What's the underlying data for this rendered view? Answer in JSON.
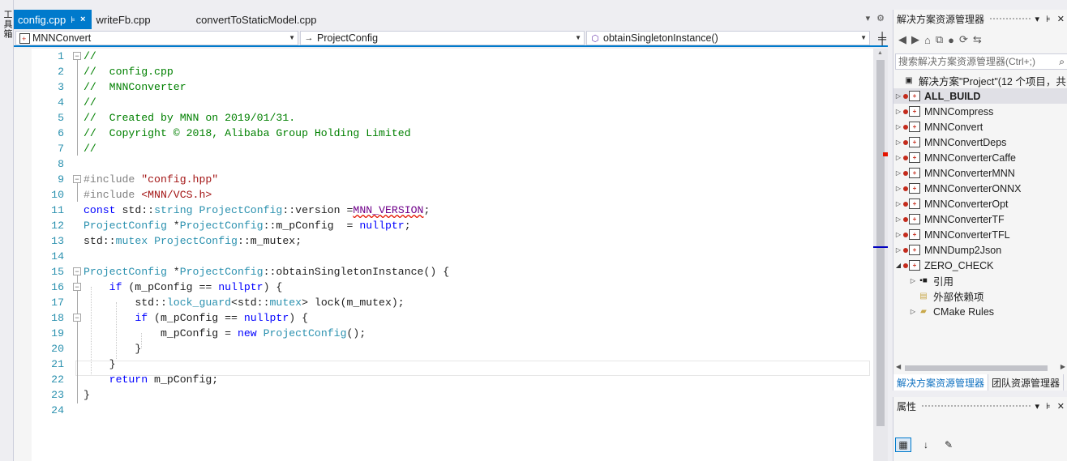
{
  "toolbox": {
    "label": "工具箱"
  },
  "tabs": [
    {
      "label": "config.cpp",
      "pin": "⊧",
      "close": "×"
    },
    {
      "label": "writeFb.cpp"
    },
    {
      "label": "convertToStaticModel.cpp"
    }
  ],
  "tab_overflow": {
    "dropdown": "▾",
    "settings": "⚙"
  },
  "nav": {
    "project": "MNNConvert",
    "scope": "ProjectConfig",
    "member": "obtainSingletonInstance()"
  },
  "code_lines": [
    {
      "n": "1",
      "text": "//"
    },
    {
      "n": "2",
      "text": "//  config.cpp"
    },
    {
      "n": "3",
      "text": "//  MNNConverter"
    },
    {
      "n": "4",
      "text": "//"
    },
    {
      "n": "5",
      "text": "//  Created by MNN on 2019/01/31."
    },
    {
      "n": "6",
      "text": "//  Copyright © 2018, Alibaba Group Holding Limited"
    },
    {
      "n": "7",
      "text": "//"
    },
    {
      "n": "8",
      "text": ""
    },
    {
      "n": "9",
      "pp": "#include ",
      "str": "\"config.hpp\""
    },
    {
      "n": "10",
      "pp": "#include ",
      "str": "<MNN/VCS.h>"
    },
    {
      "n": "11",
      "kw": "const",
      "t1": " std::",
      "ty": "string",
      "t2": " ",
      "ty2": "ProjectConfig",
      "t3": "::version =",
      "mac": "MNN_VERSION",
      "t4": ";"
    },
    {
      "n": "12",
      "ty": "ProjectConfig",
      "t1": " *",
      "ty2": "ProjectConfig",
      "t2": "::m_pConfig  = ",
      "kw": "nullptr",
      "t3": ";"
    },
    {
      "n": "13",
      "t1": "std::",
      "ty": "mutex",
      "t2": " ",
      "ty2": "ProjectConfig",
      "t3": "::m_mutex;"
    },
    {
      "n": "14",
      "text": ""
    },
    {
      "n": "15",
      "ty": "ProjectConfig",
      "t1": " *",
      "ty2": "ProjectConfig",
      "t2": "::obtainSingletonInstance() {"
    },
    {
      "n": "16",
      "ind": "    ",
      "kw": "if",
      "t1": " (m_pConfig == ",
      "kw2": "nullptr",
      "t2": ") {"
    },
    {
      "n": "17",
      "ind": "        ",
      "t1": "std::",
      "ty": "lock_guard",
      "t2": "<std::",
      "ty2": "mutex",
      "t3": "> lock(m_mutex);"
    },
    {
      "n": "18",
      "ind": "        ",
      "kw": "if",
      "t1": " (m_pConfig == ",
      "kw2": "nullptr",
      "t2": ") {"
    },
    {
      "n": "19",
      "ind": "            ",
      "t1": "m_pConfig = ",
      "kw": "new",
      "t2": " ",
      "ty": "ProjectConfig",
      "t3": "();"
    },
    {
      "n": "20",
      "ind": "        ",
      "t1": "}"
    },
    {
      "n": "21",
      "ind": "    ",
      "t1": "}"
    },
    {
      "n": "22",
      "ind": "    ",
      "kw": "return",
      "t1": " m_pConfig;"
    },
    {
      "n": "23",
      "t1": "}"
    },
    {
      "n": "24",
      "text": ""
    }
  ],
  "solution_explorer": {
    "title": "解决方案资源管理器",
    "search_placeholder": "搜索解决方案资源管理器(Ctrl+;)",
    "solution": "解决方案\"Project\"(12 个项目，共",
    "projects": [
      "ALL_BUILD",
      "MNNCompress",
      "MNNConvert",
      "MNNConvertDeps",
      "MNNConverterCaffe",
      "MNNConverterMNN",
      "MNNConverterONNX",
      "MNNConverterOpt",
      "MNNConverterTF",
      "MNNConverterTFL",
      "MNNDump2Json",
      "ZERO_CHECK"
    ],
    "children": [
      "引用",
      "外部依赖项",
      "CMake Rules"
    ],
    "tabs": [
      "解决方案资源管理器",
      "团队资源管理器"
    ]
  },
  "properties": {
    "title": "属性"
  }
}
